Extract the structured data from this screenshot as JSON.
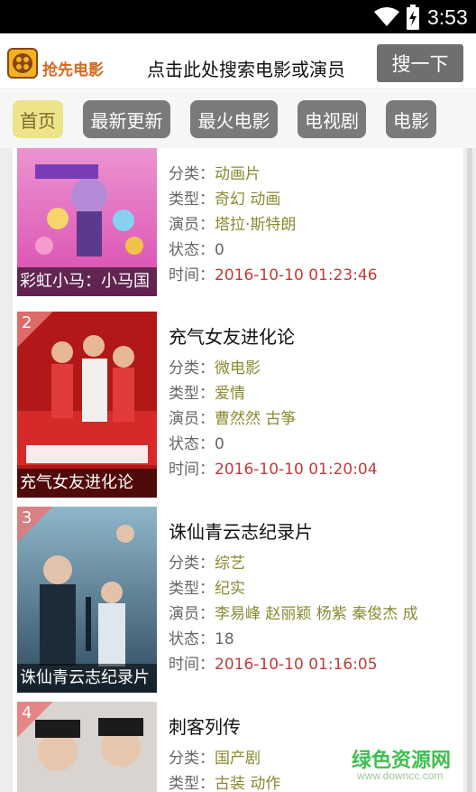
{
  "status_bar": {
    "time": "3:53"
  },
  "header": {
    "app_name": "抢先电影",
    "search_hint": "点击此处搜索电影或演员",
    "search_button": "搜一下"
  },
  "nav": {
    "tabs": [
      {
        "label": "首页",
        "active": true
      },
      {
        "label": "最新更新",
        "active": false
      },
      {
        "label": "最火电影",
        "active": false
      },
      {
        "label": "电视剧",
        "active": false
      },
      {
        "label": "电影",
        "active": false
      }
    ]
  },
  "labels": {
    "category": "分类：",
    "type": "类型：",
    "actors": "演员：",
    "status": "状态：",
    "time": "时间："
  },
  "items": [
    {
      "poster_caption": "彩虹小马：小马国",
      "category": "动画片",
      "type": "奇幻 动画",
      "actors": "塔拉·斯特朗",
      "status": "0",
      "time": "2016-10-10 01:23:46"
    },
    {
      "rank": "2",
      "title": "充气女友进化论",
      "poster_caption": "充气女友进化论",
      "category": "微电影",
      "type": "爱情",
      "actors": "曹然然 古筝",
      "status": "0",
      "time": "2016-10-10 01:20:04"
    },
    {
      "rank": "3",
      "title": "诛仙青云志纪录片",
      "poster_caption": "诛仙青云志纪录片",
      "category": "综艺",
      "type": "纪实",
      "actors": "李易峰 赵丽颖 杨紫 秦俊杰 成",
      "status": "18",
      "time": "2016-10-10 01:16:05"
    },
    {
      "rank": "4",
      "title": "刺客列传",
      "category": "国产剧",
      "type": "古装 动作"
    }
  ],
  "watermark": {
    "text": "绿色资源网",
    "url": "www.downcc.com"
  },
  "colors": {
    "accent_active_tab": "#ece38a",
    "tab_bg": "#7a7a7a",
    "value_text": "#8a8a32",
    "time_text": "#c23a3a"
  }
}
